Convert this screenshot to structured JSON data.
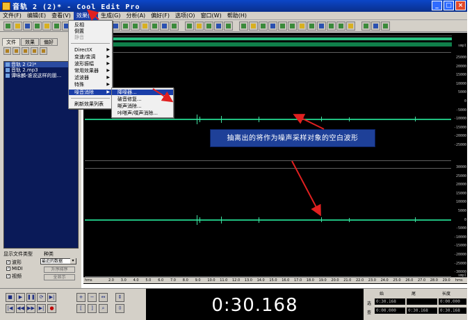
{
  "window": {
    "title": "音轨 2 (2)* - Cool Edit Pro"
  },
  "menubar": [
    {
      "label": "文件(F)"
    },
    {
      "label": "编辑(E)"
    },
    {
      "label": "查看(V)"
    },
    {
      "label": "效果(T)",
      "active": true
    },
    {
      "label": "生成(G)"
    },
    {
      "label": "分析(A)"
    },
    {
      "label": "偏好(F)"
    },
    {
      "label": "选项(O)"
    },
    {
      "label": "窗口(W)"
    },
    {
      "label": "帮助(H)"
    }
  ],
  "left_panel": {
    "tabs": [
      {
        "label": "文件"
      },
      {
        "label": "效果"
      },
      {
        "label": "偏好"
      }
    ],
    "files": [
      {
        "label": "音轨 2 (2)*"
      },
      {
        "label": "音轨 2.mp3"
      },
      {
        "label": "谭咏麟-谁说这样的朋..."
      }
    ],
    "filetypes_label": "显示文件类型",
    "sort_label": "种类",
    "filetypes": [
      {
        "label": "波形",
        "checked": true
      },
      {
        "label": "MIDI",
        "checked": true
      },
      {
        "label": "视频",
        "checked": true
      }
    ],
    "sort_value": "最近的数据",
    "btn_sort": "升序排序",
    "btn_info": "全显示"
  },
  "effects_menu": {
    "items": [
      {
        "label": "反相",
        "disabled": false
      },
      {
        "label": "倒置",
        "disabled": false
      },
      {
        "label": "静音",
        "disabled": true
      }
    ],
    "submenus": [
      {
        "label": "DirectX"
      },
      {
        "label": "变速/变调"
      },
      {
        "label": "波形振幅"
      },
      {
        "label": "常用效果器"
      },
      {
        "label": "滤波器"
      },
      {
        "label": "特殊"
      },
      {
        "label": "噪音消除",
        "highlighted": true
      }
    ],
    "refresh": "刷新效果列表"
  },
  "noise_submenu": {
    "items": [
      {
        "label": "降噪器...",
        "highlighted": true
      },
      {
        "label": "破音修复..."
      },
      {
        "label": "嘶声消除..."
      },
      {
        "label": "咔嗒声/噗声消除..."
      }
    ]
  },
  "annotation": {
    "text": "抽离出的将作为噪声采样对象的空白波形"
  },
  "amplitude_scale": {
    "unit": "smpl",
    "ch1": [
      "25000",
      "20000",
      "15000",
      "10000",
      "5000",
      "0",
      "-5000",
      "-10000",
      "-15000",
      "-20000",
      "-25000"
    ],
    "ch2": [
      "30000",
      "25000",
      "20000",
      "15000",
      "10000",
      "5000",
      "0",
      "-5000",
      "-10000",
      "-15000",
      "-20000",
      "-25000",
      "-30000"
    ]
  },
  "ruler": {
    "unit_left": "hms",
    "unit_right": "hms",
    "ticks": [
      "2.0",
      "3.0",
      "4.0",
      "5.0",
      "6.0",
      "7.0",
      "8.0",
      "9.0",
      "10.0",
      "11.0",
      "12.0",
      "13.0",
      "14.0",
      "15.0",
      "16.0",
      "17.0",
      "18.0",
      "19.0",
      "20.0",
      "21.0",
      "22.0",
      "23.0",
      "24.0",
      "25.0",
      "26.0",
      "27.0",
      "28.0",
      "29.0"
    ]
  },
  "transport": {
    "time_display": "0:30.168",
    "info_headers": [
      "始",
      "尾",
      "长度"
    ],
    "row_sel_label": "选",
    "row_view_label": "查",
    "sel_start": "0:30.168",
    "sel_end": "",
    "sel_len": "0:00.000",
    "view_start": "0:00.000",
    "view_end": "0:30.168",
    "view_len": "0:30.168"
  },
  "colors": {
    "waveform": "#20c080",
    "annotation_bg": "#1e4098",
    "arrow": "#e02020",
    "menu_highlight": "#1a3ea8"
  }
}
